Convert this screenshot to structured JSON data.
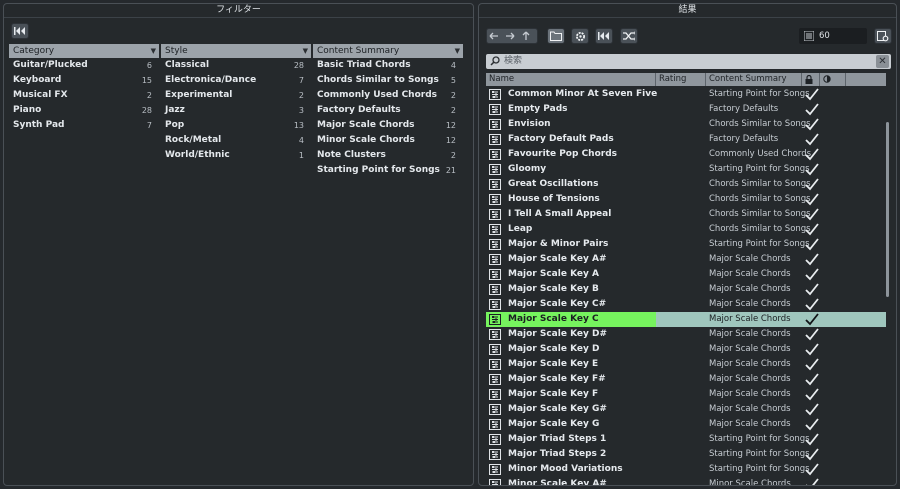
{
  "filter_panel": {
    "title": "フィルター",
    "columns": [
      {
        "header": "Category",
        "items": [
          {
            "label": "Guitar/Plucked",
            "count": "6"
          },
          {
            "label": "Keyboard",
            "count": "15"
          },
          {
            "label": "Musical FX",
            "count": "2"
          },
          {
            "label": "Piano",
            "count": "28"
          },
          {
            "label": "Synth Pad",
            "count": "7"
          }
        ]
      },
      {
        "header": "Style",
        "items": [
          {
            "label": "Classical",
            "count": "28"
          },
          {
            "label": "Electronica/Dance",
            "count": "7"
          },
          {
            "label": "Experimental",
            "count": "2"
          },
          {
            "label": "Jazz",
            "count": "3"
          },
          {
            "label": "Pop",
            "count": "13"
          },
          {
            "label": "Rock/Metal",
            "count": "4"
          },
          {
            "label": "World/Ethnic",
            "count": "1"
          }
        ]
      },
      {
        "header": "Content Summary",
        "items": [
          {
            "label": "Basic Triad Chords",
            "count": "4"
          },
          {
            "label": "Chords Similar to Songs",
            "count": "5"
          },
          {
            "label": "Commonly Used Chords",
            "count": "2"
          },
          {
            "label": "Factory Defaults",
            "count": "2"
          },
          {
            "label": "Major Scale Chords",
            "count": "12"
          },
          {
            "label": "Minor Scale Chords",
            "count": "12"
          },
          {
            "label": "Note Clusters",
            "count": "2"
          },
          {
            "label": "Starting Point for Songs",
            "count": "21"
          }
        ]
      }
    ]
  },
  "results_panel": {
    "title": "結果",
    "result_count": "60",
    "search": {
      "placeholder": "検索"
    },
    "columns": {
      "name": "Name",
      "rating": "Rating",
      "content_summary": "Content Summary"
    },
    "selected_index": 15,
    "rows": [
      {
        "name": "Common Minor At Seven Five",
        "summary": "Starting Point for Songs"
      },
      {
        "name": "Empty Pads",
        "summary": "Factory Defaults"
      },
      {
        "name": "Envision",
        "summary": "Chords Similar to Songs"
      },
      {
        "name": "Factory Default Pads",
        "summary": "Factory Defaults"
      },
      {
        "name": "Favourite Pop Chords",
        "summary": "Commonly Used Chords"
      },
      {
        "name": "Gloomy",
        "summary": "Starting Point for Songs"
      },
      {
        "name": "Great Oscillations",
        "summary": "Chords Similar to Songs"
      },
      {
        "name": "House of Tensions",
        "summary": "Chords Similar to Songs"
      },
      {
        "name": "I Tell A Small Appeal",
        "summary": "Chords Similar to Songs"
      },
      {
        "name": "Leap",
        "summary": "Chords Similar to Songs"
      },
      {
        "name": "Major & Minor Pairs",
        "summary": "Starting Point for Songs"
      },
      {
        "name": "Major Scale Key A#",
        "summary": "Major Scale Chords"
      },
      {
        "name": "Major Scale Key A",
        "summary": "Major Scale Chords"
      },
      {
        "name": "Major Scale Key B",
        "summary": "Major Scale Chords"
      },
      {
        "name": "Major Scale Key C#",
        "summary": "Major Scale Chords"
      },
      {
        "name": "Major Scale Key C",
        "summary": "Major Scale Chords"
      },
      {
        "name": "Major Scale Key D#",
        "summary": "Major Scale Chords"
      },
      {
        "name": "Major Scale Key D",
        "summary": "Major Scale Chords"
      },
      {
        "name": "Major Scale Key E",
        "summary": "Major Scale Chords"
      },
      {
        "name": "Major Scale Key F#",
        "summary": "Major Scale Chords"
      },
      {
        "name": "Major Scale Key F",
        "summary": "Major Scale Chords"
      },
      {
        "name": "Major Scale Key G#",
        "summary": "Major Scale Chords"
      },
      {
        "name": "Major Scale Key G",
        "summary": "Major Scale Chords"
      },
      {
        "name": "Major Triad Steps 1",
        "summary": "Starting Point for Songs"
      },
      {
        "name": "Major Triad Steps 2",
        "summary": "Starting Point for Songs"
      },
      {
        "name": "Minor Mood Variations",
        "summary": "Starting Point for Songs"
      },
      {
        "name": "Minor Scale Key A#",
        "summary": "Minor Scale Chords"
      }
    ]
  },
  "colors": {
    "selection_name": "#76f35e",
    "selection_row": "#9fc6bd"
  }
}
